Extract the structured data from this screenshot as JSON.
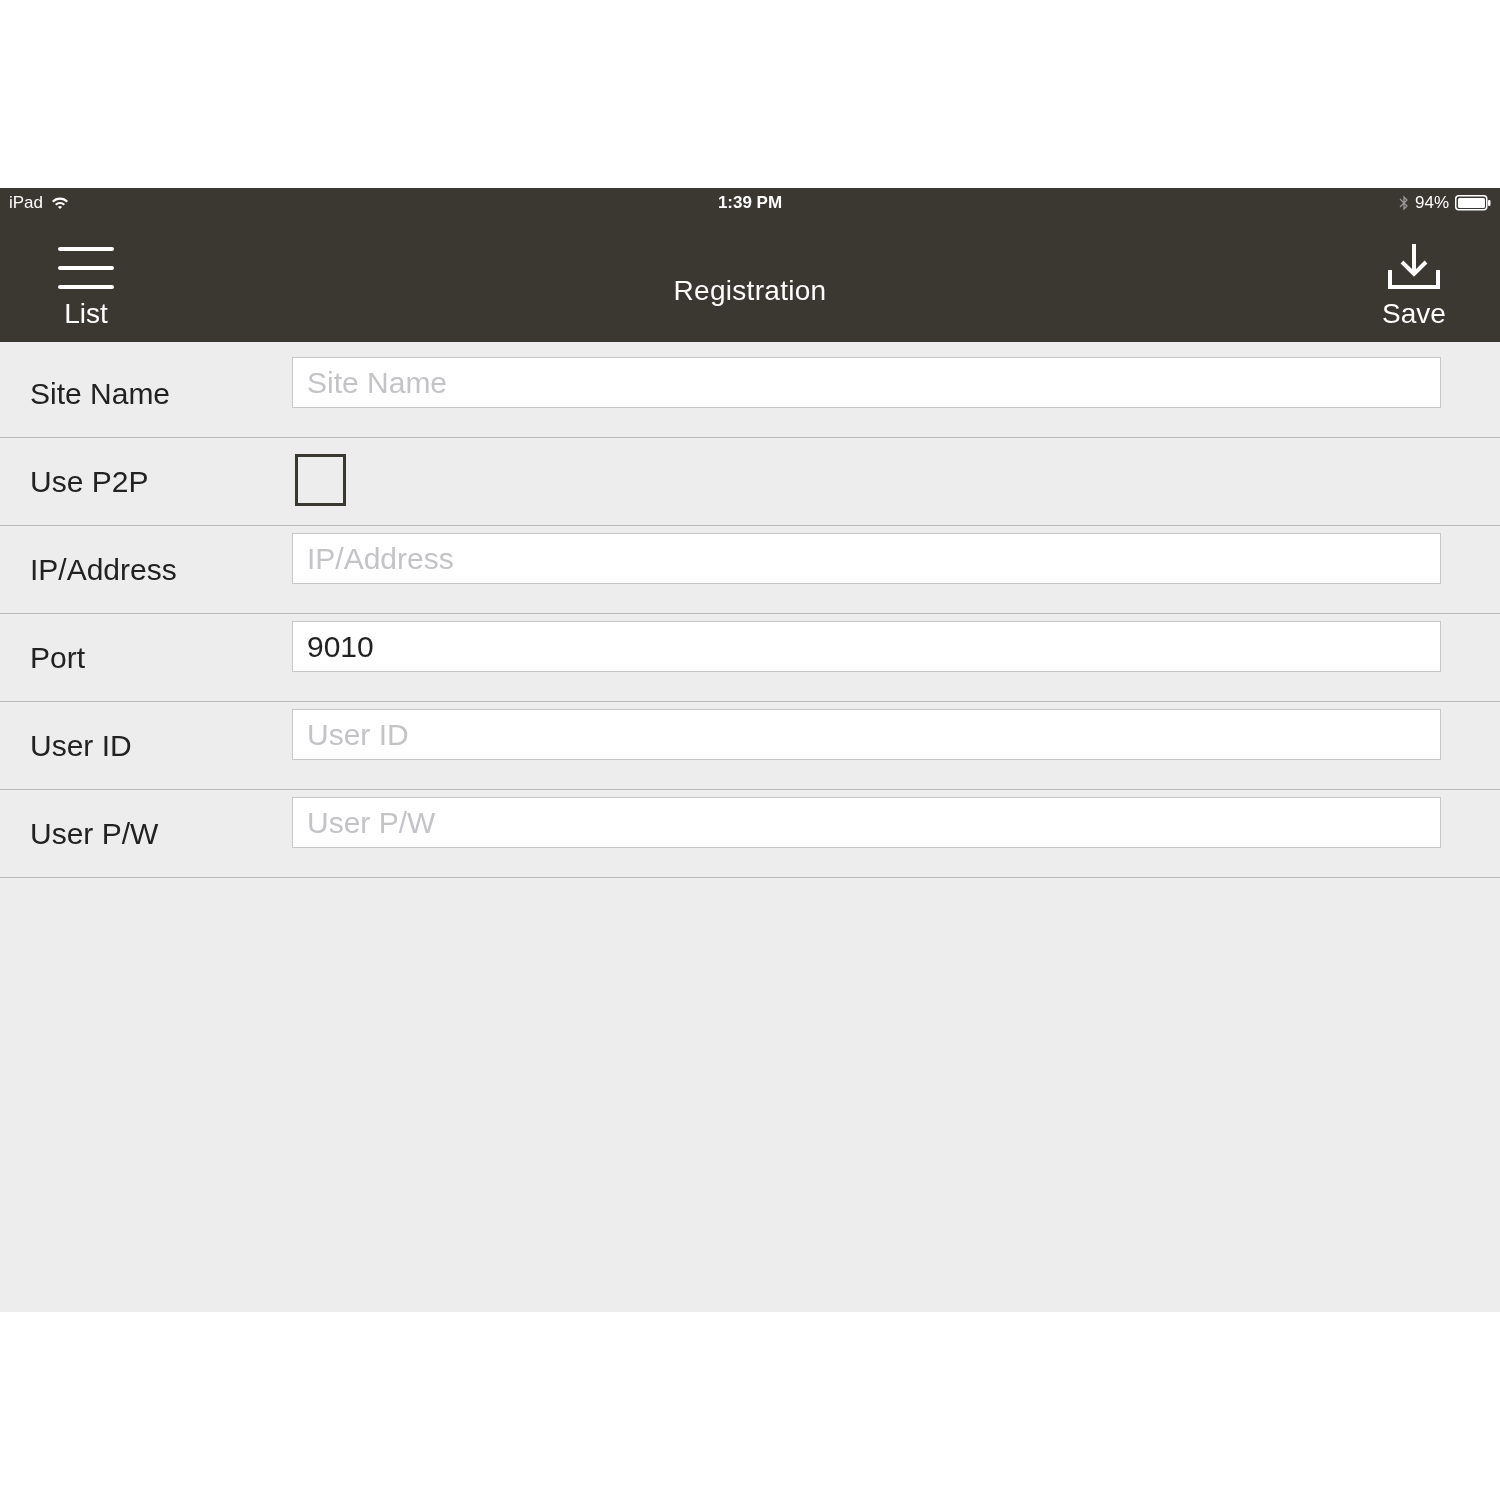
{
  "status_bar": {
    "device": "iPad",
    "time": "1:39 PM",
    "battery": "94%"
  },
  "nav_bar": {
    "left_button": "List",
    "title": "Registration",
    "right_button": "Save"
  },
  "form": [
    {
      "label": "Site Name",
      "kind": "text",
      "placeholder": "Site Name"
    },
    {
      "label": "Use P2P",
      "kind": "checkbox",
      "checked": false
    },
    {
      "label": "IP/Address",
      "kind": "text",
      "placeholder": "IP/Address"
    },
    {
      "label": "Port",
      "kind": "text",
      "value": "9010"
    },
    {
      "label": "User ID",
      "kind": "text",
      "placeholder": "User ID"
    },
    {
      "label": "User P/W",
      "kind": "text",
      "placeholder": "User P/W"
    }
  ]
}
